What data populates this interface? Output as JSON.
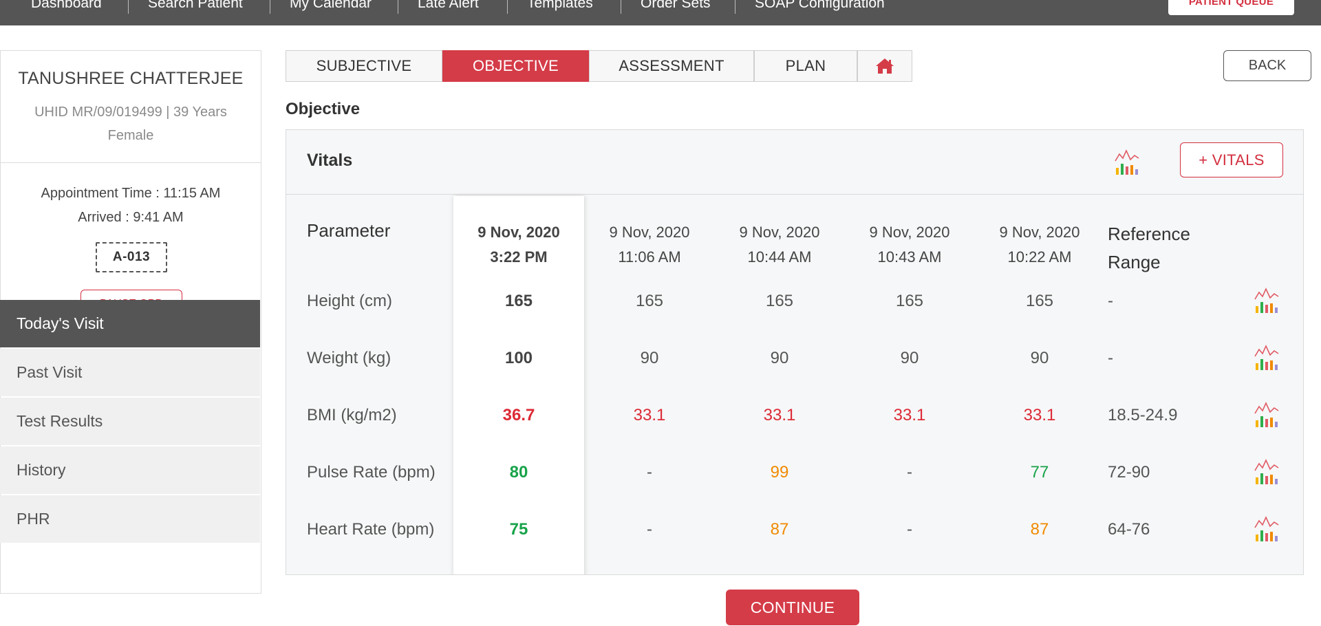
{
  "topnav": {
    "items": [
      "Dashboard",
      "Search Patient",
      "My Calendar",
      "Late Alert",
      "Templates",
      "Order Sets",
      "SOAP Configuration"
    ],
    "queue_button": "PATIENT QUEUE"
  },
  "patient": {
    "name": "TANUSHREE CHATTERJEE",
    "meta": "UHID MR/09/019499 | 39 Years Female",
    "appointment": "Appointment Time : 11:15 AM",
    "arrived": "Arrived : 9:41 AM",
    "token": "A-013",
    "pause_button": "PAUSE OPD"
  },
  "sidebar": {
    "items": [
      {
        "label": "Today's Visit",
        "active": true
      },
      {
        "label": "Past Visit"
      },
      {
        "label": "Test Results"
      },
      {
        "label": "History"
      },
      {
        "label": "PHR"
      }
    ]
  },
  "tabs": [
    {
      "label": "SUBJECTIVE"
    },
    {
      "label": "OBJECTIVE",
      "active": true
    },
    {
      "label": "ASSESSMENT"
    },
    {
      "label": "PLAN"
    },
    {
      "icon": "home-icon"
    }
  ],
  "back_button": "BACK",
  "section_title": "Objective",
  "vitals": {
    "title": "Vitals",
    "add_button": "+ VITALS",
    "chart_icon": "chart-icon",
    "param_header": "Parameter",
    "ref_header": "Reference Range",
    "dates": [
      {
        "date": "9 Nov, 2020",
        "time": "3:22 PM"
      },
      {
        "date": "9 Nov, 2020",
        "time": "11:06 AM"
      },
      {
        "date": "9 Nov, 2020",
        "time": "10:44 AM"
      },
      {
        "date": "9 Nov, 2020",
        "time": "10:43 AM"
      },
      {
        "date": "9 Nov, 2020",
        "time": "10:22 AM"
      }
    ],
    "rows": [
      {
        "label": "Height (cm)",
        "values": [
          "165",
          "165",
          "165",
          "165",
          "165"
        ],
        "status": [
          "",
          "",
          "",
          "",
          ""
        ],
        "ref": "-"
      },
      {
        "label": "Weight (kg)",
        "values": [
          "100",
          "90",
          "90",
          "90",
          "90"
        ],
        "status": [
          "",
          "",
          "",
          "",
          ""
        ],
        "ref": "-"
      },
      {
        "label": "BMI (kg/m2)",
        "values": [
          "36.7",
          "33.1",
          "33.1",
          "33.1",
          "33.1"
        ],
        "status": [
          "red",
          "red",
          "red",
          "red",
          "red"
        ],
        "ref": "18.5-24.9"
      },
      {
        "label": "Pulse Rate (bpm)",
        "values": [
          "80",
          "-",
          "99",
          "-",
          "77"
        ],
        "status": [
          "green",
          "",
          "orange",
          "",
          "green"
        ],
        "ref": "72-90"
      },
      {
        "label": "Heart Rate (bpm)",
        "values": [
          "75",
          "-",
          "87",
          "-",
          "87"
        ],
        "status": [
          "green",
          "",
          "orange",
          "",
          "orange"
        ],
        "ref": "64-76"
      }
    ],
    "status_colors": {
      "red": "#dc2a36",
      "green": "#18a34a",
      "orange": "#f08a00"
    }
  },
  "continue_button": "CONTINUE"
}
